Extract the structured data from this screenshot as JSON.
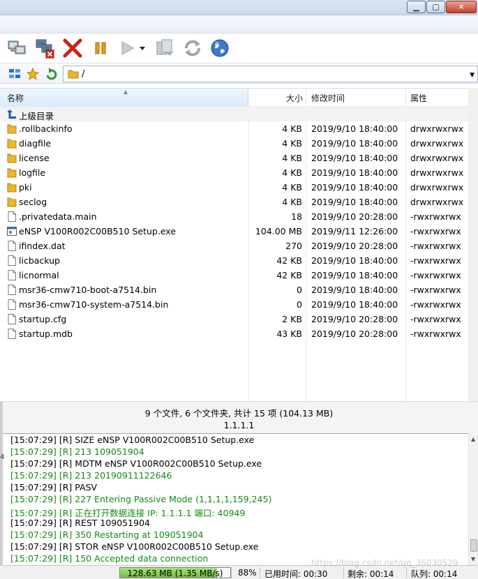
{
  "toolbar": {
    "buttons": [
      {
        "name": "connect-icon"
      },
      {
        "name": "disconnect-icon"
      },
      {
        "name": "stop-icon"
      },
      {
        "name": "pause-icon"
      },
      {
        "name": "play-icon"
      },
      {
        "name": "dropdown-arrow-icon"
      },
      {
        "name": "transfer-icon"
      },
      {
        "name": "refresh-icon"
      },
      {
        "name": "browser-globe-icon"
      }
    ]
  },
  "address": {
    "path": "/"
  },
  "filelist": {
    "columns": {
      "name": "名称",
      "size": "大小",
      "modified": "修改时间",
      "attributes": "属性"
    },
    "parent_label": "上级目录",
    "rows": [
      {
        "name": ".rollbackinfo",
        "size": "4 KB",
        "modified": "2019/9/10 18:40:00",
        "attr": "drwxrwxrwx",
        "type": "folder"
      },
      {
        "name": "diagfile",
        "size": "4 KB",
        "modified": "2019/9/10 18:40:00",
        "attr": "drwxrwxrwx",
        "type": "folder"
      },
      {
        "name": "license",
        "size": "4 KB",
        "modified": "2019/9/10 18:40:00",
        "attr": "drwxrwxrwx",
        "type": "folder"
      },
      {
        "name": "logfile",
        "size": "4 KB",
        "modified": "2019/9/10 18:40:00",
        "attr": "drwxrwxrwx",
        "type": "folder"
      },
      {
        "name": "pki",
        "size": "4 KB",
        "modified": "2019/9/10 18:40:00",
        "attr": "drwxrwxrwx",
        "type": "folder"
      },
      {
        "name": "seclog",
        "size": "4 KB",
        "modified": "2019/9/10 18:40:00",
        "attr": "drwxrwxrwx",
        "type": "folder"
      },
      {
        "name": ".privatedata.main",
        "size": "18",
        "modified": "2019/9/10 20:28:00",
        "attr": "-rwxrwxrwx",
        "type": "file"
      },
      {
        "name": "eNSP V100R002C00B510 Setup.exe",
        "size": "104.00 MB",
        "modified": "2019/9/11 12:26:00",
        "attr": "-rwxrwxrwx",
        "type": "exe"
      },
      {
        "name": "ifindex.dat",
        "size": "270",
        "modified": "2019/9/10 20:28:00",
        "attr": "-rwxrwxrwx",
        "type": "file"
      },
      {
        "name": "licbackup",
        "size": "42 KB",
        "modified": "2019/9/10 18:40:00",
        "attr": "-rwxrwxrwx",
        "type": "file"
      },
      {
        "name": "licnormal",
        "size": "42 KB",
        "modified": "2019/9/10 18:40:00",
        "attr": "-rwxrwxrwx",
        "type": "file"
      },
      {
        "name": "msr36-cmw710-boot-a7514.bin",
        "size": "0",
        "modified": "2019/9/10 18:40:00",
        "attr": "-rwxrwxrwx",
        "type": "file"
      },
      {
        "name": "msr36-cmw710-system-a7514.bin",
        "size": "0",
        "modified": "2019/9/10 18:40:00",
        "attr": "-rwxrwxrwx",
        "type": "file"
      },
      {
        "name": "startup.cfg",
        "size": "2 KB",
        "modified": "2019/9/10 20:28:00",
        "attr": "-rwxrwxrwx",
        "type": "file"
      },
      {
        "name": "startup.mdb",
        "size": "43 KB",
        "modified": "2019/9/10 20:28:00",
        "attr": "-rwxrwxrwx",
        "type": "file"
      }
    ]
  },
  "status": {
    "summary": "9 个文件, 6 个文件夹, 共计 15 项 (104.13 MB)",
    "host": "1.1.1.1"
  },
  "log": {
    "side_marker": "4",
    "lines": [
      {
        "text": "[15:07:29]  [R]  SIZE eNSP V100R002C00B510 Setup.exe",
        "color": "black"
      },
      {
        "text": "[15:07:29]  [R]  213 109051904",
        "color": "green"
      },
      {
        "text": "[15:07:29]  [R]  MDTM eNSP V100R002C00B510 Setup.exe",
        "color": "black"
      },
      {
        "text": "[15:07:29]  [R]  213 20190911122646",
        "color": "green"
      },
      {
        "text": "[15:07:29]  [R]  PASV",
        "color": "black"
      },
      {
        "text": "[15:07:29]  [R]  227 Entering Passive Mode (1,1,1,1,159,245)",
        "color": "green"
      },
      {
        "text": "[15:07:29]  [R]  正在打开数据连接 IP: 1.1.1.1 端口: 40949",
        "color": "green"
      },
      {
        "text": "[15:07:29]  [R]  REST 109051904",
        "color": "black"
      },
      {
        "text": "[15:07:29]  [R]  350 Restarting at 109051904",
        "color": "green"
      },
      {
        "text": "[15:07:29]  [R]  STOR eNSP V100R002C00B510 Setup.exe",
        "color": "black"
      },
      {
        "text": "[15:07:29]  [R]  150 Accepted data connection",
        "color": "green"
      }
    ]
  },
  "bottom": {
    "progress_text": "128.63 MB (1.35 MB/s)",
    "progress_fraction": 0.88,
    "percent": "88%",
    "elapsed": "已用时间: 00:30",
    "remaining": "剩余: 00:14",
    "queue": "队列: 00:14",
    "watermark": "https://blog.csdn.net/qq_36030529"
  },
  "colors": {
    "log_green": "#128a12",
    "folder": "#e8b72c",
    "progress": "#6fbd3e"
  }
}
